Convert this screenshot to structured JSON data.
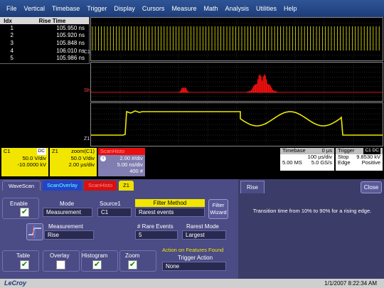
{
  "menu": [
    "File",
    "Vertical",
    "Timebase",
    "Trigger",
    "Display",
    "Cursors",
    "Measure",
    "Math",
    "Analysis",
    "Utilities",
    "Help"
  ],
  "table": {
    "headers": [
      "Idx",
      "Rise Time"
    ],
    "rows": [
      {
        "idx": "1",
        "value": "105.950 ns"
      },
      {
        "idx": "2",
        "value": "105.920 ns"
      },
      {
        "idx": "3",
        "value": "105.848 ns"
      },
      {
        "idx": "4",
        "value": "106.010 ns"
      },
      {
        "idx": "5",
        "value": "105.986 ns"
      }
    ]
  },
  "grid_labels": {
    "c1": "C1",
    "sh": "Sh",
    "z1": "Z1"
  },
  "channels": {
    "c1": {
      "name": "C1",
      "tag": "DC",
      "vdiv": "50.0 V/div",
      "offset": "-10.0000 kV"
    },
    "z1": {
      "name": "Z1",
      "src": "zoom(C1)",
      "vdiv": "50.0 V/div",
      "tdiv": "2.00 µs/div"
    },
    "sh": {
      "name": "ScanHisto",
      "line1": "2.00 #/div",
      "line2": "5.00 ns/div",
      "line3": "400 #"
    }
  },
  "timebase": {
    "title": "Timebase",
    "delay": "0 µs",
    "tdiv": "100 µs/div",
    "samples": "5.00 MS",
    "rate": "5.0 GS/s"
  },
  "trigger": {
    "title": "Trigger",
    "tags": "C1 DC",
    "mode": "Stop",
    "level": "9.8530 kV",
    "type": "Edge",
    "slope": "Positive"
  },
  "dialog": {
    "tabs": [
      "WaveScan",
      "ScanOverlay",
      "ScanHisto",
      "Z1"
    ],
    "enable_label": "Enable",
    "mode_label": "Mode",
    "mode_value": "Measurement",
    "source_label": "Source1",
    "source_value": "C1",
    "filter_label": "Filter Method",
    "filter_value": "Rarest events",
    "wizard_label": "Filter Wizard",
    "measurement_label": "Measurement",
    "measurement_value": "Rise",
    "rare_events_label": "# Rare Events",
    "rare_events_value": "5",
    "rarest_mode_label": "Rarest Mode",
    "rarest_mode_value": "Largest",
    "table_label": "Table",
    "overlay_label": "Overlay",
    "histogram_label": "Histogram",
    "zoom_label": "Zoom",
    "action_title": "Action on Features Found",
    "trigger_action_label": "Trigger Action",
    "trigger_action_value": "None",
    "checks": {
      "enable": true,
      "table": true,
      "overlay": false,
      "histogram": true,
      "zoom": true
    }
  },
  "right": {
    "tab": "Rise",
    "close": "Close",
    "help": "Transition time from 10% to 90% for a rising edge."
  },
  "status": {
    "logo": "LeCroy",
    "datetime": "1/1/2007 8:22:34 AM"
  },
  "colors": {
    "trace": "#ece800",
    "histogram": "#ff1010",
    "accent": "#2f5597"
  }
}
